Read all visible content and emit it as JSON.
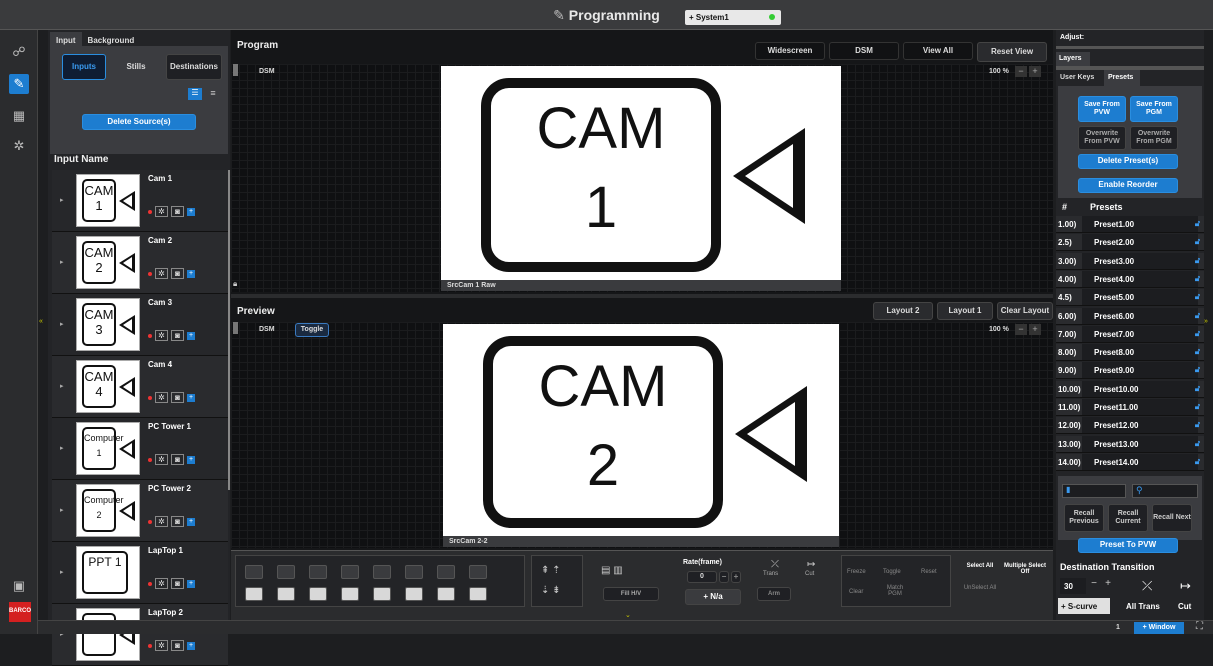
{
  "title": "Programming",
  "system": {
    "label": "+ System1"
  },
  "input_panel": {
    "tabs": [
      "Input",
      "Background"
    ],
    "subtabs": [
      "Inputs",
      "Stills",
      "Destinations"
    ],
    "delete_label": "Delete Source(s)",
    "list_header": "Input Name",
    "sources": [
      {
        "name": "Cam 1",
        "thumb_top": "CAM",
        "thumb_bottom": "1"
      },
      {
        "name": "Cam 2",
        "thumb_top": "CAM",
        "thumb_bottom": "2"
      },
      {
        "name": "Cam 3",
        "thumb_top": "CAM",
        "thumb_bottom": "3"
      },
      {
        "name": "Cam 4",
        "thumb_top": "CAM",
        "thumb_bottom": "4"
      },
      {
        "name": "PC Tower 1",
        "thumb_top": "Computer",
        "thumb_bottom": "1"
      },
      {
        "name": "PC Tower 2",
        "thumb_top": "Computer",
        "thumb_bottom": "2"
      },
      {
        "name": "LapTop 1",
        "thumb_top": "PPT 1",
        "thumb_bottom": ""
      },
      {
        "name": "LapTop 2",
        "thumb_top": "",
        "thumb_bottom": ""
      }
    ]
  },
  "program": {
    "title": "Program",
    "buttons": [
      "Widescreen",
      "DSM",
      "View All",
      "Reset View"
    ],
    "dsm": "DSM",
    "zoom": "100 %",
    "cam_top": "CAM",
    "cam_bottom": "1",
    "caption": "SrcCam 1 Raw"
  },
  "preview": {
    "title": "Preview",
    "buttons": [
      "Layout 2",
      "Layout 1",
      "Clear Layout"
    ],
    "dsm": "DSM",
    "toggle": "Toggle",
    "zoom": "100 %",
    "cam_top": "CAM",
    "cam_bottom": "2",
    "caption": "SrcCam 2-2"
  },
  "tools": {
    "fill": "Fill H/V",
    "rate_label": "Rate(frame)",
    "rate_value": "0",
    "na": "+ N/a",
    "trans": "Trans",
    "cut": "Cut",
    "arm": "Arm",
    "freeze": "Freeze",
    "toggle": "Toggle",
    "reset": "Reset",
    "clear": "Clear",
    "match_pgm": "Match PGM",
    "select_all": "Select All",
    "multiple_off": "Multiple Select Off",
    "unselect_all": "UnSelect All"
  },
  "right_panel": {
    "adjust": "Adjust:",
    "layers": "Layers",
    "tabs": [
      "User Keys",
      "Presets"
    ],
    "save_pvw": "Save From PVW",
    "save_pgm": "Save From PGM",
    "overwrite_pvw": "Overwrite From PVW",
    "overwrite_pgm": "Overwrite From PGM",
    "delete_presets": "Delete Preset(s)",
    "enable_reorder": "Enable Reorder",
    "col_num": "#",
    "col_presets": "Presets",
    "presets": [
      {
        "n": "1.00)",
        "name": "Preset1.00"
      },
      {
        "n": "2.5)",
        "name": "Preset2.00"
      },
      {
        "n": "3.00)",
        "name": "Preset3.00"
      },
      {
        "n": "4.00)",
        "name": "Preset4.00"
      },
      {
        "n": "4.5)",
        "name": "Preset5.00"
      },
      {
        "n": "6.00)",
        "name": "Preset6.00"
      },
      {
        "n": "7.00)",
        "name": "Preset7.00"
      },
      {
        "n": "8.00)",
        "name": "Preset8.00"
      },
      {
        "n": "9.00)",
        "name": "Preset9.00"
      },
      {
        "n": "10.00)",
        "name": "Preset10.00"
      },
      {
        "n": "11.00)",
        "name": "Preset11.00"
      },
      {
        "n": "12.00)",
        "name": "Preset12.00"
      },
      {
        "n": "13.00)",
        "name": "Preset13.00"
      },
      {
        "n": "14.00)",
        "name": "Preset14.00"
      }
    ],
    "recall_prev": "Recall Previous",
    "recall_cur": "Recall Current",
    "recall_next": "Recall Next",
    "preset_to_pvw": "Preset To PVW",
    "dest_trans": "Destination Transition",
    "dest_value": "30",
    "scurve": "+ S-curve",
    "all_trans": "All Trans",
    "cut": "Cut"
  },
  "status": {
    "page": "1",
    "window": "+ Window"
  },
  "brand": "BARCO"
}
